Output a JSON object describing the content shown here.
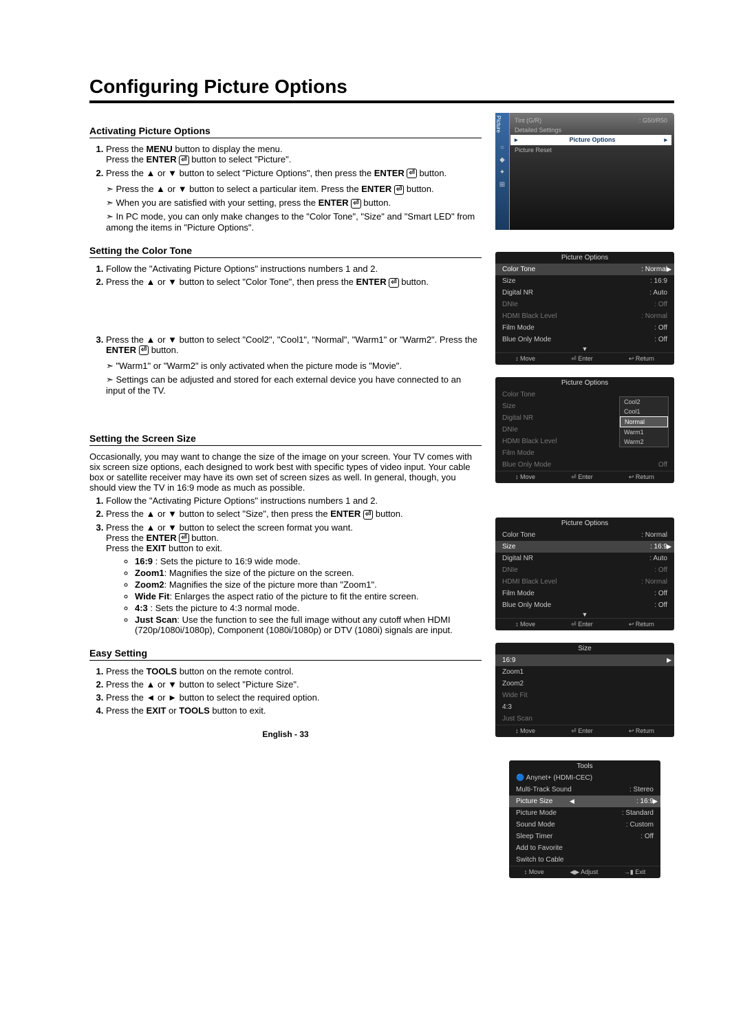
{
  "page_title": "Configuring Picture Options",
  "page_num": "English - 33",
  "sec1": {
    "head": "Activating Picture Options",
    "s1a": "Press the ",
    "s1b": "MENU",
    "s1c": " button to display the menu.",
    "s1d": "Press the ",
    "s1e": "ENTER",
    "s1f": " button to select \"Picture\".",
    "s2a": "Press the ▲ or ▼ button to select \"Picture Options\", then press the ",
    "s2b": "ENTER",
    "s2c": " button.",
    "n1": "Press the ▲ or ▼ button to select a particular item. Press the ",
    "n1b": "ENTER",
    "n1c": " button.",
    "n2": "When you are satisfied with your setting, press the ",
    "n2b": "ENTER",
    "n2c": " button.",
    "n3": "In PC mode, you can only make changes to the \"Color Tone\", \"Size\" and \"Smart LED\" from among the items in \"Picture Options\"."
  },
  "sec2": {
    "head": "Setting the Color Tone",
    "s1": "Follow the \"Activating Picture Options\" instructions numbers 1 and 2.",
    "s2a": "Press the ▲ or ▼ button to select \"Color Tone\", then press the ",
    "s2b": "ENTER",
    "s2c": " button.",
    "s3a": "Press the ▲ or ▼ button to select \"Cool2\", \"Cool1\", \"Normal\", \"Warm1\" or \"Warm2\". Press the ",
    "s3b": "ENTER",
    "s3c": " button.",
    "n1": "\"Warm1\" or \"Warm2\" is only activated when the picture mode is \"Movie\".",
    "n2": "Settings can be adjusted and stored for each external device you have connected to an input of the TV."
  },
  "sec3": {
    "head": "Setting the Screen Size",
    "intro": "Occasionally, you may want to change the size of the image on your screen. Your TV comes with six screen size options, each designed to work best with specific types of video input. Your cable box or satellite receiver may have its own set of screen sizes as well. In general, though, you should view the TV in 16:9 mode as much as possible.",
    "s1": "Follow the \"Activating Picture Options\" instructions numbers 1 and 2.",
    "s2a": "Press the ▲ or ▼ button to select \"Size\", then press the ",
    "s2b": "ENTER",
    "s2c": " button.",
    "s3a": "Press the ▲ or ▼ button to select the screen format you want.",
    "s3b": "Press the ",
    "s3c": "ENTER",
    "s3d": " button.",
    "s3e": "Press the ",
    "s3f": "EXIT",
    "s3g": " button to exit.",
    "b1": "16:9",
    "b1d": " : Sets the picture to 16:9 wide mode.",
    "b2": "Zoom1",
    "b2d": ": Magnifies the size of the picture on the screen.",
    "b3": "Zoom2",
    "b3d": ": Magnifies the size of the picture more than \"Zoom1\".",
    "b4": "Wide Fit",
    "b4d": ": Enlarges the aspect ratio of the picture to fit the entire screen.",
    "b5": "4:3",
    "b5d": " : Sets the picture to 4:3 normal mode.",
    "b6": "Just Scan",
    "b6d": ": Use the function to see the full image without any cutoff when HDMI (720p/1080i/1080p), Component (1080i/1080p) or DTV (1080i) signals are input."
  },
  "sec4": {
    "head": "Easy Setting",
    "s1a": "Press the ",
    "s1b": "TOOLS",
    "s1c": " button on the remote control.",
    "s2": "Press the ▲ or ▼ button to select \"Picture Size\".",
    "s3": "Press the ◄ or ► button to select the required option.",
    "s4a": "Press the ",
    "s4b": "EXIT",
    "s4c": " or ",
    "s4d": "TOOLS",
    "s4e": " button to exit."
  },
  "tv1": {
    "strip": "Picture",
    "r1k": "Tint (G/R)",
    "r1v": ": G50/R50",
    "r2k": "Detailed Settings",
    "r3k": "Picture Options",
    "r4k": "Picture Reset"
  },
  "osd1": {
    "title": "Picture Options",
    "rows": [
      {
        "k": "Color Tone",
        "v": ": Normal",
        "hl": true
      },
      {
        "k": "Size",
        "v": ": 16:9"
      },
      {
        "k": "Digital NR",
        "v": ": Auto"
      },
      {
        "k": "DNIe",
        "v": ": Off",
        "dim": true
      },
      {
        "k": "HDMI Black Level",
        "v": ": Normal",
        "dim": true
      },
      {
        "k": "Film Mode",
        "v": ": Off"
      },
      {
        "k": "Blue Only Mode",
        "v": ": Off"
      }
    ],
    "more": "▼",
    "foot": {
      "a": "↕ Move",
      "b": "⏎ Enter",
      "c": "↩ Return"
    }
  },
  "osd2": {
    "title": "Picture Options",
    "rows": [
      {
        "k": "Color Tone",
        "dim": true
      },
      {
        "k": "Size",
        "dim": true
      },
      {
        "k": "Digital NR",
        "dim": true
      },
      {
        "k": "DNIe",
        "dim": true
      },
      {
        "k": "HDMI Black Level",
        "dim": true
      },
      {
        "k": "Film Mode",
        "dim": true
      },
      {
        "k": "Blue Only Mode",
        "v": "Off",
        "dim": true
      }
    ],
    "popup": [
      "Cool2",
      "Cool1",
      "Normal",
      "Warm1",
      "Warm2"
    ],
    "popup_sel": "Normal",
    "foot": {
      "a": "↕ Move",
      "b": "⏎ Enter",
      "c": "↩ Return"
    }
  },
  "osd3": {
    "title": "Picture Options",
    "rows": [
      {
        "k": "Color Tone",
        "v": ": Normal"
      },
      {
        "k": "Size",
        "v": ": 16:9",
        "hl": true
      },
      {
        "k": "Digital NR",
        "v": ": Auto"
      },
      {
        "k": "DNIe",
        "v": ": Off",
        "dim": true
      },
      {
        "k": "HDMI Black Level",
        "v": ": Normal",
        "dim": true
      },
      {
        "k": "Film Mode",
        "v": ": Off"
      },
      {
        "k": "Blue Only Mode",
        "v": ": Off"
      }
    ],
    "more": "▼",
    "foot": {
      "a": "↕ Move",
      "b": "⏎ Enter",
      "c": "↩ Return"
    }
  },
  "osd4": {
    "title": "Size",
    "items": [
      "16:9",
      "Zoom1",
      "Zoom2",
      "Wide Fit",
      "4:3",
      "Just Scan"
    ],
    "sel": "16:9",
    "foot": {
      "a": "↕ Move",
      "b": "⏎ Enter",
      "c": "↩ Return"
    }
  },
  "osd5": {
    "title": "Tools",
    "rows": [
      {
        "k": "Anynet+ (HDMI-CEC)",
        "v": "",
        "badge": true
      },
      {
        "k": "Multi-Track Sound",
        "v": "Stereo",
        "sep": ":"
      },
      {
        "k": "Picture Size",
        "v": "16:9",
        "sep": ":",
        "hl": true
      },
      {
        "k": "Picture Mode",
        "v": "Standard",
        "sep": ":"
      },
      {
        "k": "Sound Mode",
        "v": "Custom",
        "sep": ":"
      },
      {
        "k": "Sleep Timer",
        "v": "Off",
        "sep": ":"
      },
      {
        "k": "Add to Favorite",
        "v": ""
      },
      {
        "k": "Switch to Cable",
        "v": ""
      }
    ],
    "foot": {
      "a": "↕ Move",
      "b": "◀▶ Adjust",
      "c": "→▮ Exit"
    }
  }
}
